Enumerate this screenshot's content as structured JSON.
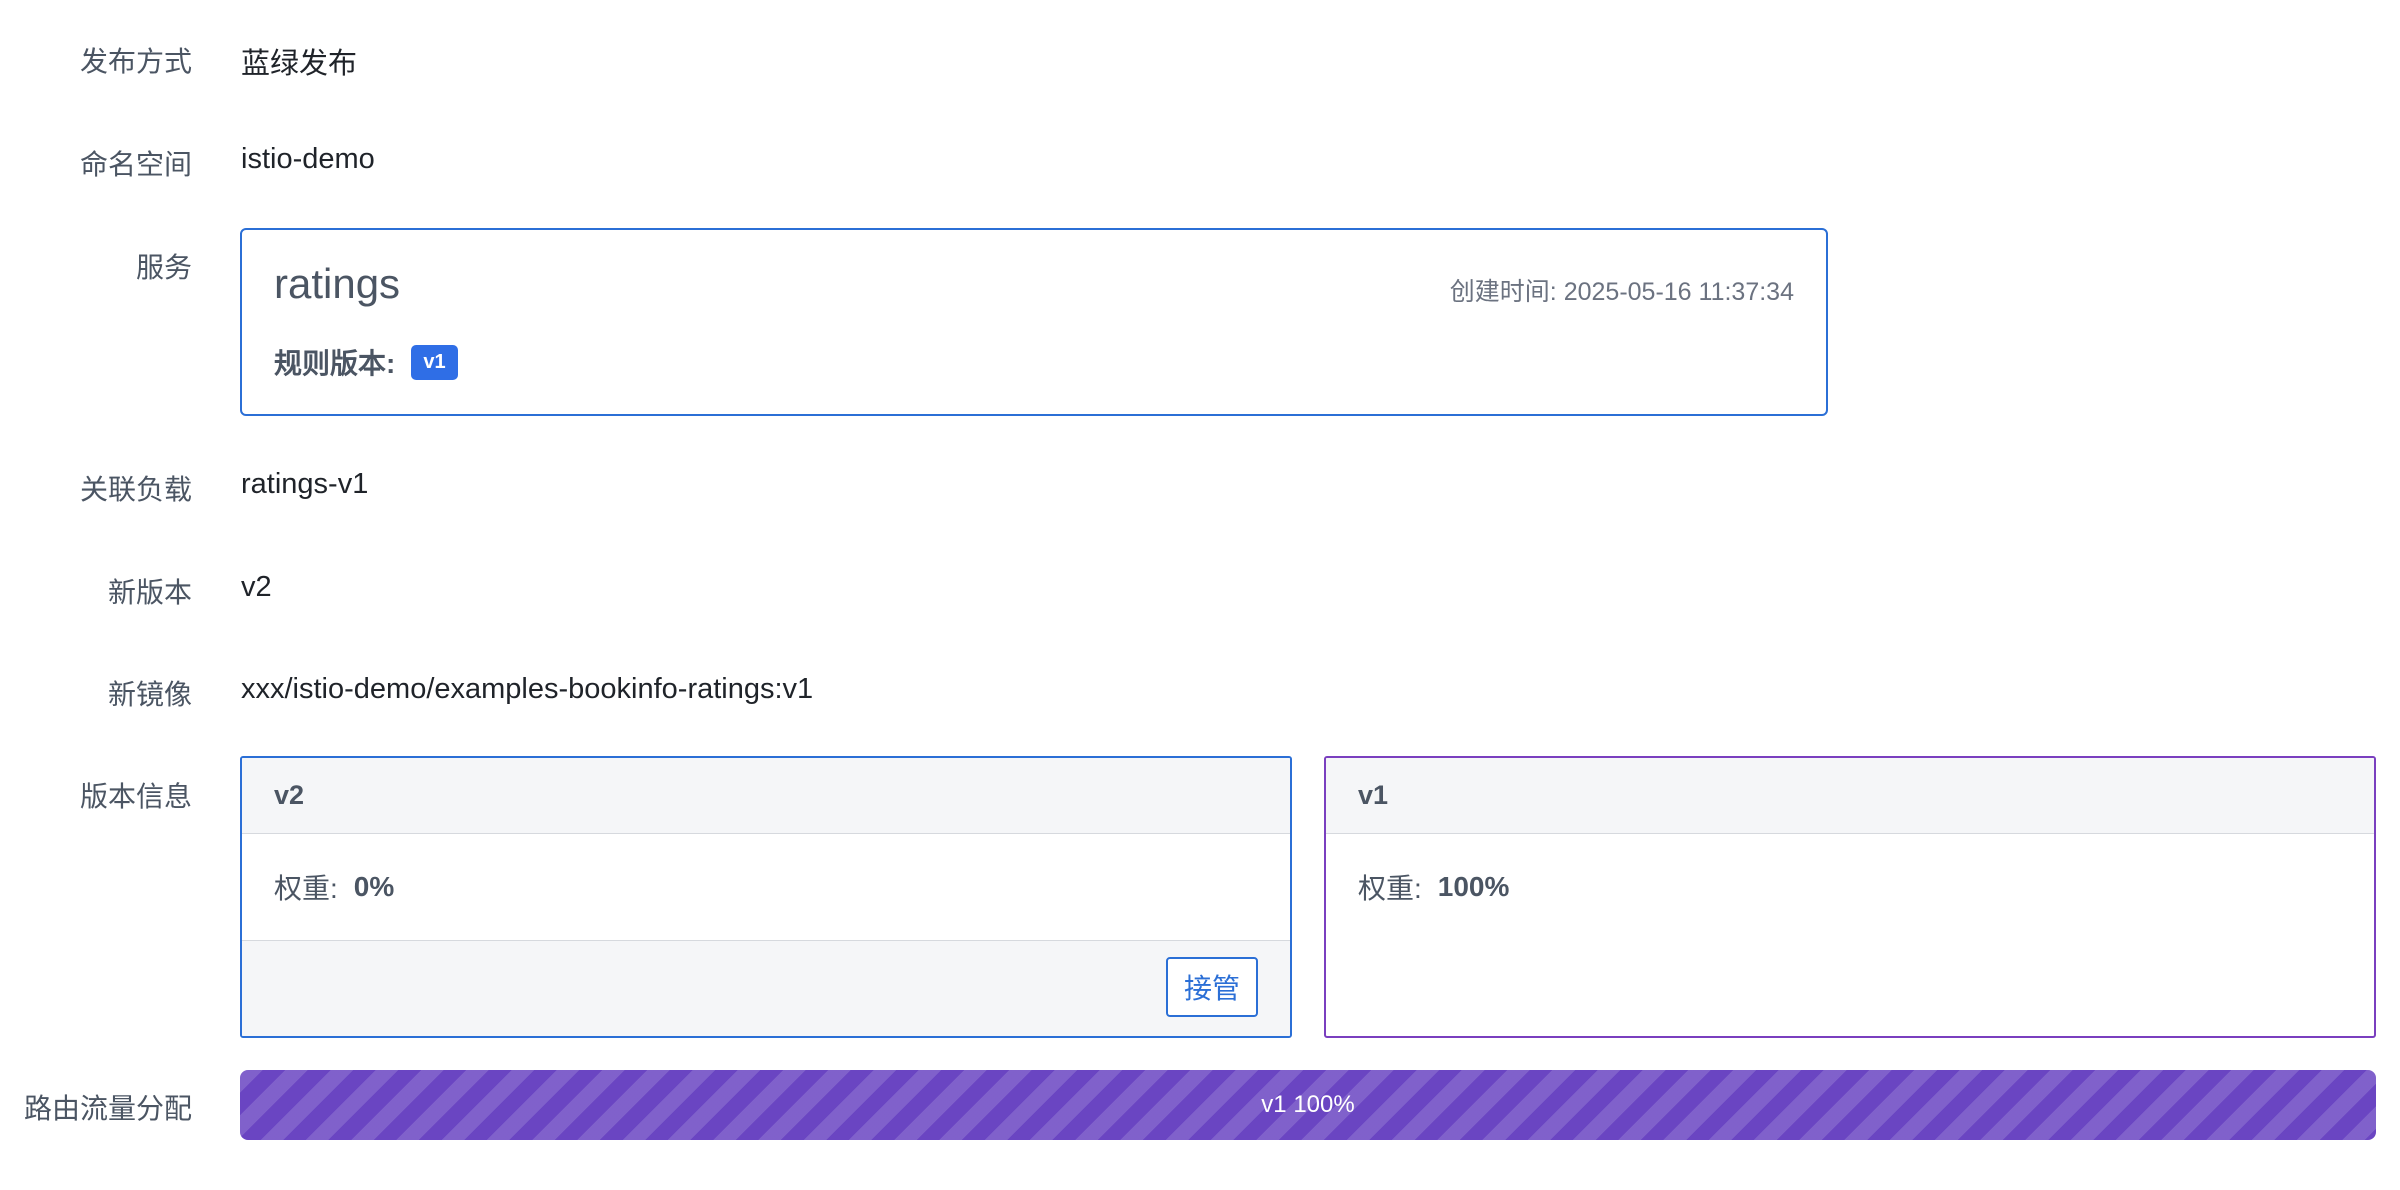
{
  "fields": {
    "release_method": {
      "label": "发布方式",
      "value": "蓝绿发布"
    },
    "namespace": {
      "label": "命名空间",
      "value": "istio-demo"
    },
    "service": {
      "label": "服务"
    },
    "workload": {
      "label": "关联负载",
      "value": "ratings-v1"
    },
    "new_version": {
      "label": "新版本",
      "value": "v2"
    },
    "new_image": {
      "label": "新镜像",
      "value": "xxx/istio-demo/examples-bookinfo-ratings:v1"
    },
    "version_info": {
      "label": "版本信息"
    },
    "traffic": {
      "label": "路由流量分配"
    }
  },
  "service_card": {
    "name": "ratings",
    "created_label": "创建时间: ",
    "created_value": "2025-05-16 11:37:34",
    "rule_version_label": "规则版本:",
    "rule_version_badge": "v1"
  },
  "versions": [
    {
      "name": "v2",
      "weight_label": "权重:",
      "weight_value": "0%",
      "action_label": "接管",
      "border_color": "#2b6fd6"
    },
    {
      "name": "v1",
      "weight_label": "权重:",
      "weight_value": "100%",
      "border_color": "#7a3fbf"
    }
  ],
  "traffic_bar": {
    "segments": [
      {
        "version": "v1",
        "percent": 100,
        "text": "v1 100%",
        "color": "#6a45c2"
      }
    ]
  }
}
